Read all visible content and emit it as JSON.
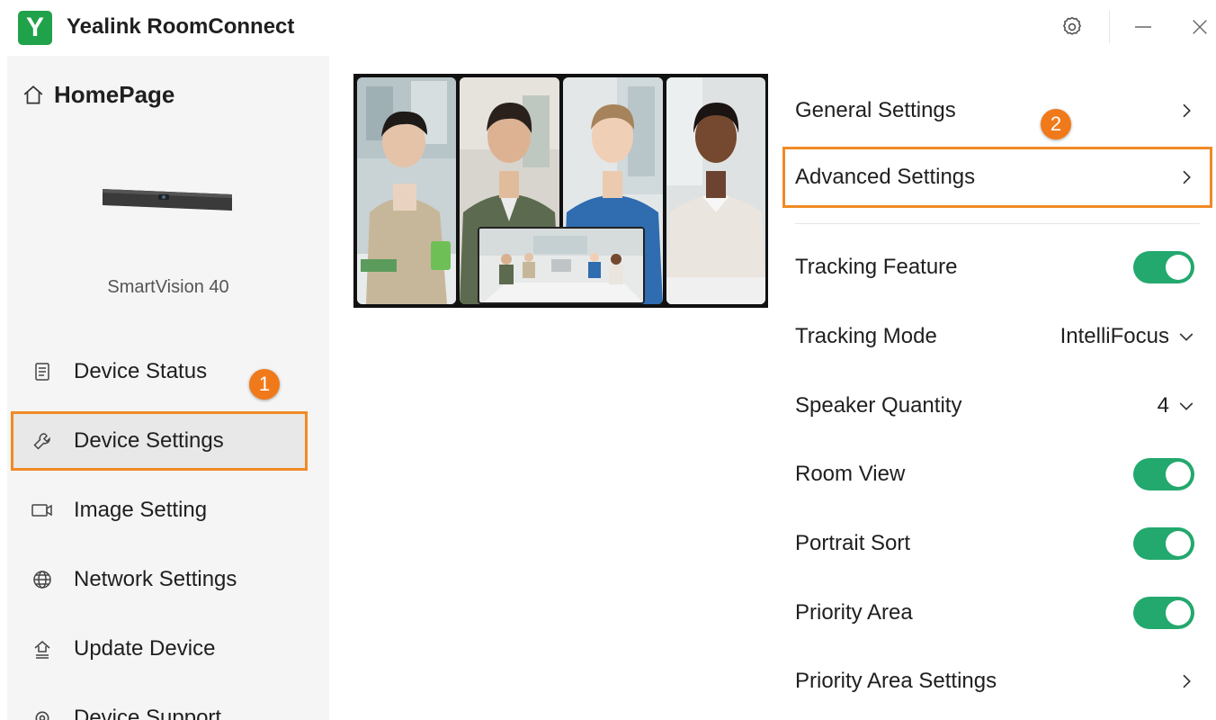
{
  "app": {
    "logo_letter": "Y",
    "title": "Yealink RoomConnect",
    "brand_color": "#1fa24a",
    "window_controls": [
      "settings-icon",
      "minimize-icon",
      "close-icon"
    ]
  },
  "sidebar": {
    "home_label": "HomePage",
    "device_name": "SmartVision 40",
    "items": [
      {
        "label": "Device Status",
        "icon": "document-icon"
      },
      {
        "label": "Device Settings",
        "icon": "wrench-icon",
        "active": true
      },
      {
        "label": "Image Setting",
        "icon": "camera-icon"
      },
      {
        "label": "Network Settings",
        "icon": "globe-icon"
      },
      {
        "label": "Update Device",
        "icon": "upload-icon"
      },
      {
        "label": "Device Support",
        "icon": "support-icon"
      }
    ]
  },
  "annotations": {
    "badge1": "1",
    "badge2": "2",
    "highlight_color": "#f08a24"
  },
  "settings": {
    "general": "General Settings",
    "advanced": "Advanced Settings",
    "tracking_feature": {
      "label": "Tracking Feature",
      "on": true
    },
    "tracking_mode": {
      "label": "Tracking Mode",
      "value": "IntelliFocus"
    },
    "speaker_quantity": {
      "label": "Speaker Quantity",
      "value": "4"
    },
    "room_view": {
      "label": "Room View",
      "on": true
    },
    "portrait_sort": {
      "label": "Portrait Sort",
      "on": true
    },
    "priority_area": {
      "label": "Priority Area",
      "on": true
    },
    "priority_area_settings": "Priority Area Settings",
    "toggle_color": "#23a86e"
  }
}
